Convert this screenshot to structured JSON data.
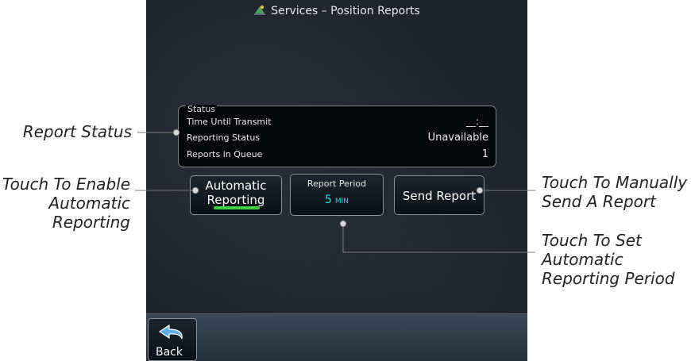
{
  "screen": {
    "title": "Services – Position Reports",
    "status": {
      "legend": "Status",
      "rows": [
        {
          "label": "Time Until Transmit",
          "value": "__:__"
        },
        {
          "label": "Reporting Status",
          "value": "Unavailable"
        },
        {
          "label": "Reports in Queue",
          "value": "1"
        }
      ]
    },
    "buttons": {
      "automatic_line1": "Automatic",
      "automatic_line2": "Reporting",
      "period_label": "Report Period",
      "period_value": "5",
      "period_unit": "MIN",
      "send": "Send Report",
      "back": "Back"
    },
    "automatic_indicator_color": "#3fd23f",
    "period_value_color": "#33d9e8"
  },
  "callouts": {
    "report_status": "Report Status",
    "enable_line1": "Touch To Enable",
    "enable_line2": "Automatic",
    "enable_line3": "Reporting",
    "send_line1": "Touch To Manually",
    "send_line2": "Send A Report",
    "period_line1": "Touch To Set",
    "period_line2": "Automatic",
    "period_line3": "Reporting Period"
  }
}
